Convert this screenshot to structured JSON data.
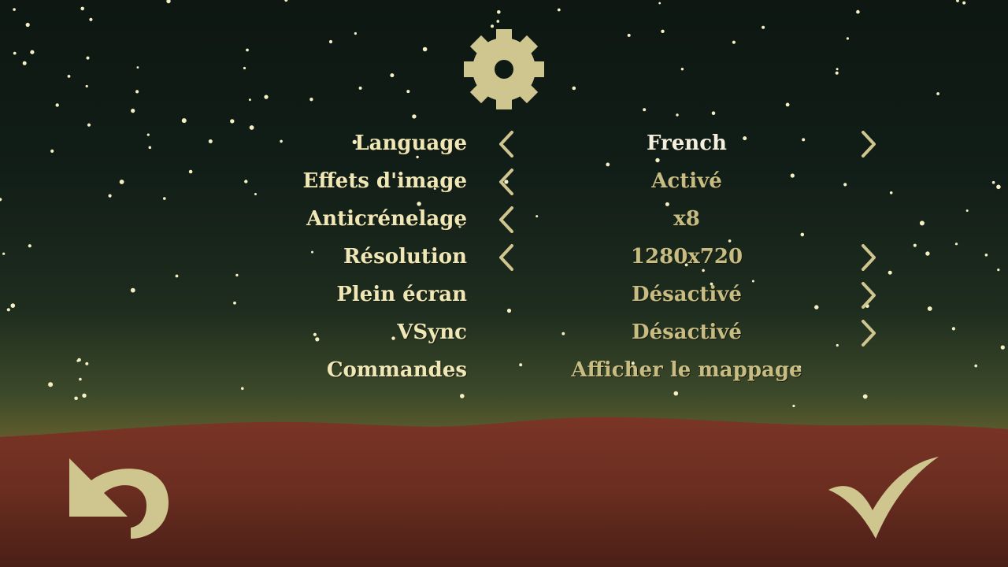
{
  "colors": {
    "label": "#efe7b6",
    "value": "#c7bd82",
    "value_active": "#f4f0e0",
    "ui_accent": "#cfc68f",
    "ground": "#6e2f22"
  },
  "header": {
    "icon": "gear-icon"
  },
  "settings": [
    {
      "label": "Language",
      "value": "French"
    },
    {
      "label": "Effets d'image",
      "value": "Activé"
    },
    {
      "label": "Anticrénelage",
      "value": "x8"
    },
    {
      "label": "Résolution",
      "value": "1280x720"
    },
    {
      "label": "Plein écran",
      "value": "Désactivé"
    },
    {
      "label": "VSync",
      "value": "Désactivé"
    },
    {
      "label": "Commandes",
      "value": "Afficher le mappage"
    }
  ],
  "footer": {
    "back_icon": "undo-arrow-icon",
    "confirm_icon": "checkmark-icon"
  }
}
